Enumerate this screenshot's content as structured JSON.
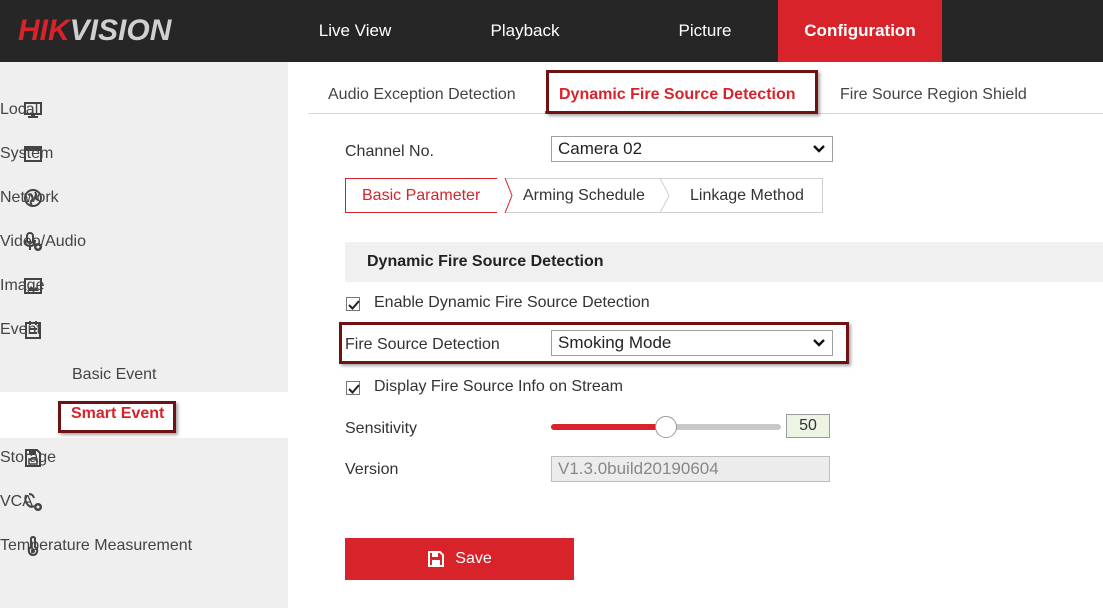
{
  "brand": {
    "part1": "HIK",
    "part2": "VISION"
  },
  "topnav": {
    "live_view": "Live View",
    "playback": "Playback",
    "picture": "Picture",
    "configuration": "Configuration"
  },
  "sidebar": {
    "local": "Local",
    "system": "System",
    "network": "Network",
    "video_audio": "Video/Audio",
    "image": "Image",
    "event": "Event",
    "basic_event": "Basic Event",
    "smart_event": "Smart Event",
    "storage": "Storage",
    "vca": "VCA",
    "temperature": "Temperature Measurement"
  },
  "subtabs": {
    "audio": "Audio Exception Detection",
    "dynamic": "Dynamic Fire Source Detection",
    "shield": "Fire Source Region Shield"
  },
  "form": {
    "channel_label": "Channel No.",
    "channel_value": "Camera 02",
    "steps": {
      "basic": "Basic Parameter",
      "arming": "Arming Schedule",
      "linkage": "Linkage Method"
    },
    "section_title": "Dynamic Fire Source Detection",
    "enable_label": "Enable Dynamic Fire Source Detection",
    "enable_checked": true,
    "fsd_label": "Fire Source Detection",
    "fsd_value": "Smoking Mode",
    "display_label": "Display Fire Source Info on Stream",
    "display_checked": true,
    "sensitivity_label": "Sensitivity",
    "sensitivity_value": "50",
    "version_label": "Version",
    "version_value": "V1.3.0build20190604",
    "save_label": "Save"
  },
  "colors": {
    "accent": "#d8232a",
    "highlight_box": "#6d1313",
    "topbar": "#262626"
  }
}
